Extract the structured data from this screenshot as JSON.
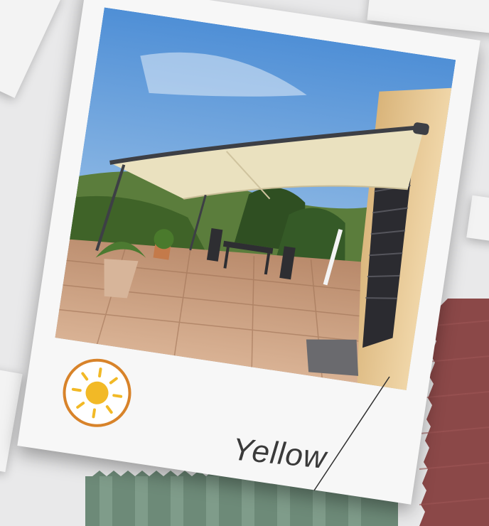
{
  "caption": "Yellow",
  "icons": {
    "badge": "sun-icon"
  },
  "colors": {
    "badge_ring": "#d8832a",
    "badge_sun": "#f2b926",
    "swatch_green": "#6d8a78",
    "swatch_red": "#8b4848"
  }
}
